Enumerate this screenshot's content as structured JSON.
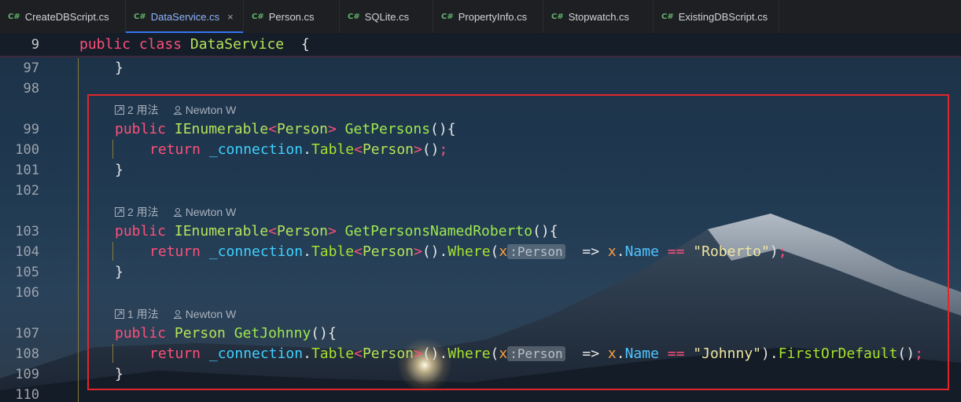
{
  "tabs": [
    {
      "lang": "C#",
      "label": "CreateDBScript.cs",
      "active": false
    },
    {
      "lang": "C#",
      "label": "DataService.cs",
      "active": true,
      "close": "×"
    },
    {
      "lang": "C#",
      "label": "Person.cs",
      "active": false
    },
    {
      "lang": "C#",
      "label": "SQLite.cs",
      "active": false
    },
    {
      "lang": "C#",
      "label": "PropertyInfo.cs",
      "active": false
    },
    {
      "lang": "C#",
      "label": "Stopwatch.cs",
      "active": false
    },
    {
      "lang": "C#",
      "label": "ExistingDBScript.cs",
      "active": false
    }
  ],
  "sticky": {
    "line": "9",
    "kw1": "public",
    "kw2": "class",
    "name": "DataService",
    "brace": "{"
  },
  "lines": {
    "l97": "97",
    "l98": "98",
    "l99": "99",
    "l100": "100",
    "l101": "101",
    "l102": "102",
    "l103": "103",
    "l104": "104",
    "l105": "105",
    "l106": "106",
    "l107": "107",
    "l108": "108",
    "l109": "109",
    "l110": "110"
  },
  "lens": [
    {
      "usages": "2 用法",
      "author": "Newton W"
    },
    {
      "usages": "2 用法",
      "author": "Newton W"
    },
    {
      "usages": "1 用法",
      "author": "Newton W"
    }
  ],
  "code": {
    "close_brace": "}",
    "public": "public",
    "return": "return",
    "ienumerable": "IEnumerable",
    "person": "Person",
    "get_persons": "GetPersons",
    "get_persons_named_roberto": "GetPersonsNamedRoberto",
    "get_johnny": "GetJohnny",
    "connection": "_connection",
    "table": "Table",
    "where": "Where",
    "first_or_default": "FirstOrDefault",
    "x": "x",
    "hint": ":Person",
    "name": "Name",
    "roberto": "\"Roberto\"",
    "johnny": "\"Johnny\""
  },
  "colors": {
    "red_box": "#e0262b",
    "keyword": "#ff4f7a",
    "type": "#b5e35a",
    "field": "#3fd0ff",
    "active_tab": "#8fb4ff"
  }
}
